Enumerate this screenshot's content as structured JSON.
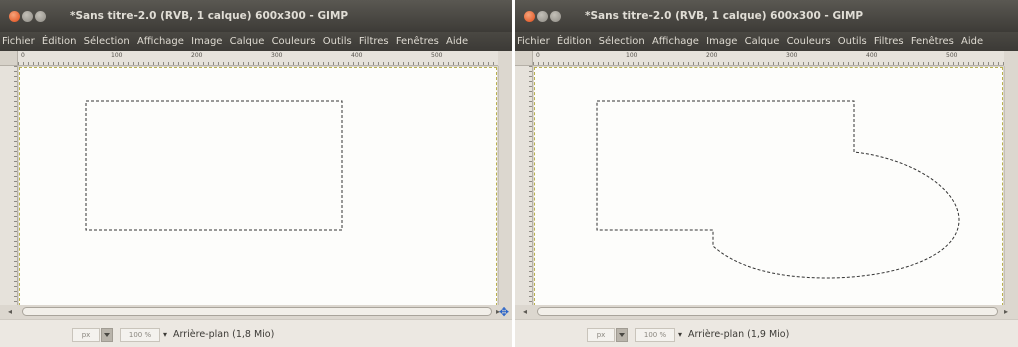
{
  "windows": [
    {
      "title": "*Sans titre-2.0 (RVB, 1 calque) 600x300 - GIMP",
      "menu": [
        "Fichier",
        "Édition",
        "Sélection",
        "Affichage",
        "Image",
        "Calque",
        "Couleurs",
        "Outils",
        "Filtres",
        "Fenêtres",
        "Aide"
      ],
      "ruler_ticks": [
        "0",
        "100",
        "200",
        "300",
        "400",
        "500"
      ],
      "unit": "px",
      "zoom": "100 %",
      "status": "Arrière-plan (1,8 Mio)"
    },
    {
      "title": "*Sans titre-2.0 (RVB, 1 calque) 600x300 - GIMP",
      "menu": [
        "Fichier",
        "Édition",
        "Sélection",
        "Affichage",
        "Image",
        "Calque",
        "Couleurs",
        "Outils",
        "Filtres",
        "Fenêtres",
        "Aide"
      ],
      "ruler_ticks": [
        "0",
        "100",
        "200",
        "300",
        "400",
        "500"
      ],
      "unit": "px",
      "zoom": "100 %",
      "status": "Arrière-plan (1,9 Mio)"
    }
  ],
  "icons": {
    "close": "close-icon",
    "minimize": "minimize-icon",
    "maximize": "maximize-icon",
    "navigate": "navigate-icon"
  }
}
